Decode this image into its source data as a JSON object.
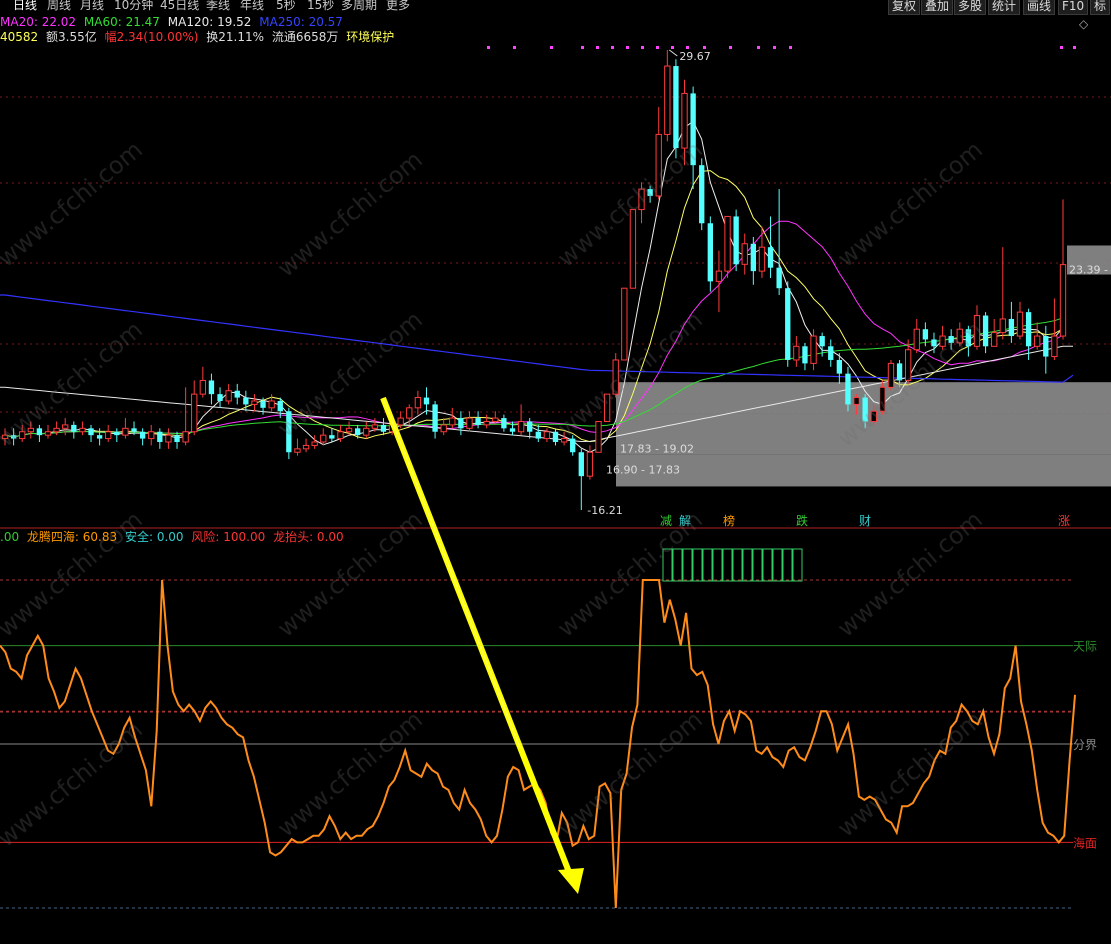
{
  "toolbar": {
    "periods": [
      "日线",
      "周线",
      "月线",
      "10分钟",
      "45日线",
      "季线",
      "年线",
      "5秒",
      "15秒",
      "多周期",
      "更多"
    ],
    "active_period": "日线",
    "arrow_label": "",
    "right_buttons": [
      "复权",
      "叠加",
      "多股",
      "统计",
      "画线",
      "F10",
      "标"
    ]
  },
  "ma_legend": [
    {
      "label": "MA20: 22.02",
      "color": "#ff33ff"
    },
    {
      "label": "MA60: 21.47",
      "color": "#33dd33"
    },
    {
      "label": "MA120: 19.52",
      "color": "#e8e8e8"
    },
    {
      "label": "MA250: 20.57",
      "color": "#3333ff"
    }
  ],
  "info_row": [
    {
      "label": "40582",
      "color": "#ffff55"
    },
    {
      "label": "额3.55亿",
      "color": "#dddddd"
    },
    {
      "label": "幅2.34(10.00%)",
      "color": "#ff3333"
    },
    {
      "label": "换21.11%",
      "color": "#dddddd"
    },
    {
      "label": "流通6658万",
      "color": "#dddddd"
    },
    {
      "label": "环境保护",
      "color": "#ffff55"
    }
  ],
  "indicator_legend": [
    {
      "label": ".00",
      "color": "#33cc33"
    },
    {
      "label": "龙腾四海: 60.83",
      "color": "#ff9900"
    },
    {
      "label": "安全: 0.00",
      "color": "#33cccc"
    },
    {
      "label": "风险: 100.00",
      "color": "#ff3333"
    },
    {
      "label": "龙抬头: 0.00",
      "color": "#ff3333"
    }
  ],
  "watermark": "www.cfchi.com",
  "chart_data": [
    {
      "type": "candlestick",
      "price_labels": [
        {
          "text": "29.67",
          "price": 29.67
        },
        {
          "text": "23.39 -",
          "price": 23.39
        },
        {
          "text": "-16.21",
          "price": 16.21
        }
      ],
      "zone_labels": [
        {
          "text": "17.83 - 19.02",
          "low": 17.83,
          "high": 19.02
        },
        {
          "text": "16.90 - 17.83",
          "low": 16.9,
          "high": 17.83
        }
      ],
      "event_markers": [
        {
          "text": "减",
          "color": "#33cc33"
        },
        {
          "text": "解",
          "color": "#33cccc"
        },
        {
          "text": "榜",
          "color": "#ff9900"
        },
        {
          "text": "跌",
          "color": "#33cc33"
        },
        {
          "text": "财",
          "color": "#33cccc"
        },
        {
          "text": "涨",
          "color": "#ff3333"
        }
      ],
      "series": [
        {
          "name": "MA20",
          "color": "#ff33ff"
        },
        {
          "name": "MA60",
          "color": "#33dd33"
        },
        {
          "name": "MA120",
          "color": "#e8e8e8"
        },
        {
          "name": "MA250",
          "color": "#3333ff"
        }
      ],
      "zones": [
        {
          "low": 16.9,
          "high": 17.83,
          "color": "#8a8a8a"
        },
        {
          "low": 17.83,
          "high": 19.02,
          "color": "#8a8a8a"
        },
        {
          "low": 19.02,
          "high": 19.95,
          "color": "#8a8a8a"
        },
        {
          "low": 23.1,
          "high": 23.95,
          "color": "#8a8a8a"
        }
      ],
      "candles": [
        [
          18.3,
          18.4,
          18.6,
          18.1
        ],
        [
          18.4,
          18.3,
          18.6,
          18.1
        ],
        [
          18.3,
          18.5,
          18.7,
          18.2
        ],
        [
          18.5,
          18.6,
          18.8,
          18.3
        ],
        [
          18.6,
          18.4,
          18.7,
          18.2
        ],
        [
          18.4,
          18.5,
          18.7,
          18.3
        ],
        [
          18.5,
          18.6,
          18.8,
          18.4
        ],
        [
          18.6,
          18.7,
          18.9,
          18.4
        ],
        [
          18.7,
          18.5,
          18.8,
          18.3
        ],
        [
          18.5,
          18.6,
          18.8,
          18.4
        ],
        [
          18.6,
          18.4,
          18.7,
          18.2
        ],
        [
          18.4,
          18.3,
          18.6,
          18.1
        ],
        [
          18.3,
          18.5,
          18.7,
          18.2
        ],
        [
          18.5,
          18.4,
          18.6,
          18.2
        ],
        [
          18.4,
          18.6,
          18.9,
          18.3
        ],
        [
          18.6,
          18.5,
          18.8,
          18.4
        ],
        [
          18.5,
          18.3,
          18.6,
          18.1
        ],
        [
          18.3,
          18.5,
          18.7,
          18.1
        ],
        [
          18.5,
          18.2,
          18.6,
          18.0
        ],
        [
          18.2,
          18.4,
          18.6,
          18.0
        ],
        [
          18.4,
          18.2,
          18.5,
          18.0
        ],
        [
          18.2,
          18.5,
          19.8,
          18.1
        ],
        [
          18.5,
          19.6,
          20.0,
          18.4
        ],
        [
          19.6,
          20.0,
          20.4,
          19.5
        ],
        [
          20.0,
          19.6,
          20.2,
          19.3
        ],
        [
          19.6,
          19.4,
          19.8,
          19.2
        ],
        [
          19.4,
          19.7,
          19.9,
          19.3
        ],
        [
          19.7,
          19.5,
          19.9,
          19.3
        ],
        [
          19.5,
          19.3,
          19.7,
          19.1
        ],
        [
          19.3,
          19.4,
          19.6,
          19.1
        ],
        [
          19.4,
          19.2,
          19.5,
          19.0
        ],
        [
          19.2,
          19.4,
          19.6,
          19.1
        ],
        [
          19.4,
          19.1,
          19.5,
          18.9
        ],
        [
          19.1,
          17.9,
          19.2,
          17.7
        ],
        [
          17.9,
          18.0,
          18.3,
          17.8
        ],
        [
          18.0,
          18.1,
          18.3,
          17.9
        ],
        [
          18.1,
          18.2,
          18.4,
          18.0
        ],
        [
          18.2,
          18.4,
          18.6,
          18.1
        ],
        [
          18.4,
          18.3,
          18.6,
          18.2
        ],
        [
          18.3,
          18.5,
          18.7,
          18.2
        ],
        [
          18.5,
          18.6,
          18.8,
          18.4
        ],
        [
          18.6,
          18.4,
          18.7,
          18.3
        ],
        [
          18.4,
          18.6,
          18.8,
          18.3
        ],
        [
          18.6,
          18.7,
          18.9,
          18.5
        ],
        [
          18.7,
          18.5,
          18.9,
          18.4
        ],
        [
          18.5,
          18.7,
          19.0,
          18.4
        ],
        [
          18.7,
          18.9,
          19.1,
          18.6
        ],
        [
          18.9,
          19.2,
          19.3,
          18.7
        ],
        [
          19.2,
          19.5,
          19.7,
          19.0
        ],
        [
          19.5,
          19.3,
          19.8,
          19.0
        ],
        [
          19.3,
          18.5,
          19.4,
          18.3
        ],
        [
          18.5,
          18.7,
          18.9,
          18.4
        ],
        [
          18.7,
          18.9,
          19.2,
          18.6
        ],
        [
          18.9,
          18.6,
          19.1,
          18.4
        ],
        [
          18.6,
          18.9,
          19.1,
          18.5
        ],
        [
          18.9,
          18.7,
          19.1,
          18.6
        ],
        [
          18.7,
          18.8,
          19.0,
          18.6
        ],
        [
          18.8,
          18.9,
          19.1,
          18.7
        ],
        [
          18.9,
          18.6,
          19.0,
          18.5
        ],
        [
          18.6,
          18.5,
          18.8,
          18.4
        ],
        [
          18.5,
          18.8,
          19.3,
          18.4
        ],
        [
          18.8,
          18.5,
          18.9,
          18.3
        ],
        [
          18.5,
          18.3,
          18.7,
          18.2
        ],
        [
          18.3,
          18.5,
          18.6,
          18.2
        ],
        [
          18.5,
          18.2,
          18.6,
          18.1
        ],
        [
          18.2,
          18.3,
          18.5,
          18.1
        ],
        [
          18.3,
          17.9,
          18.4,
          17.8
        ],
        [
          17.9,
          17.2,
          18.0,
          16.21
        ],
        [
          17.2,
          17.9,
          18.1,
          17.1
        ],
        [
          17.9,
          18.8,
          18.8,
          17.9
        ],
        [
          18.8,
          19.6,
          19.6,
          18.8
        ],
        [
          19.6,
          20.6,
          20.8,
          19.5
        ],
        [
          20.6,
          22.7,
          22.7,
          20.6
        ],
        [
          22.7,
          25.0,
          25.0,
          22.7
        ],
        [
          25.0,
          25.6,
          25.8,
          24.6
        ],
        [
          25.6,
          25.4,
          25.7,
          25.2
        ],
        [
          25.4,
          27.2,
          28.0,
          25.3
        ],
        [
          27.2,
          29.2,
          29.67,
          27.0
        ],
        [
          29.2,
          26.8,
          29.4,
          26.5
        ],
        [
          26.8,
          28.4,
          28.8,
          26.3
        ],
        [
          28.4,
          26.3,
          28.6,
          25.6
        ],
        [
          26.3,
          24.6,
          26.5,
          24.4
        ],
        [
          24.6,
          22.9,
          24.8,
          22.6
        ],
        [
          22.9,
          23.2,
          23.8,
          22.0
        ],
        [
          23.2,
          24.8,
          24.8,
          23.0
        ],
        [
          24.8,
          23.4,
          25.0,
          23.2
        ],
        [
          23.4,
          24.0,
          24.3,
          23.1
        ],
        [
          24.0,
          23.2,
          24.2,
          22.8
        ],
        [
          23.2,
          23.9,
          24.5,
          23.0
        ],
        [
          23.9,
          23.3,
          24.8,
          23.0
        ],
        [
          23.3,
          22.7,
          25.6,
          22.5
        ],
        [
          22.7,
          20.6,
          22.9,
          20.4
        ],
        [
          20.6,
          21.0,
          21.3,
          20.4
        ],
        [
          21.0,
          20.5,
          21.1,
          20.3
        ],
        [
          20.5,
          21.3,
          21.5,
          20.3
        ],
        [
          21.3,
          21.0,
          21.4,
          20.7
        ],
        [
          21.0,
          20.6,
          21.2,
          20.4
        ],
        [
          20.6,
          20.2,
          20.8,
          19.9
        ],
        [
          20.2,
          19.3,
          20.4,
          19.1
        ],
        [
          19.3,
          19.5,
          19.6,
          19.0
        ],
        [
          19.5,
          18.8,
          19.6,
          18.6
        ],
        [
          18.8,
          19.1,
          19.3,
          18.7
        ],
        [
          19.1,
          19.8,
          20.0,
          19.0
        ],
        [
          19.8,
          20.5,
          20.6,
          19.7
        ],
        [
          20.5,
          20.0,
          20.6,
          19.8
        ],
        [
          20.0,
          20.9,
          21.2,
          19.9
        ],
        [
          20.9,
          21.5,
          21.8,
          20.8
        ],
        [
          21.5,
          21.2,
          21.7,
          21.0
        ],
        [
          21.2,
          21.0,
          21.4,
          20.8
        ],
        [
          21.0,
          21.3,
          21.6,
          20.9
        ],
        [
          21.3,
          21.1,
          21.5,
          20.9
        ],
        [
          21.1,
          21.5,
          21.7,
          21.0
        ],
        [
          21.5,
          21.0,
          21.6,
          20.7
        ],
        [
          21.0,
          21.9,
          22.2,
          20.9
        ],
        [
          21.9,
          21.0,
          22.0,
          20.8
        ],
        [
          21.0,
          21.4,
          21.8,
          21.0
        ],
        [
          21.4,
          21.8,
          23.9,
          21.2
        ],
        [
          21.8,
          21.3,
          22.3,
          21.1
        ],
        [
          21.3,
          22.0,
          22.3,
          21.2
        ],
        [
          22.0,
          21.0,
          22.1,
          20.6
        ],
        [
          21.0,
          21.3,
          21.7,
          20.9
        ],
        [
          21.3,
          20.7,
          21.6,
          20.2
        ],
        [
          20.7,
          21.3,
          22.4,
          20.6
        ],
        [
          21.3,
          23.39,
          25.3,
          21.2
        ]
      ]
    },
    {
      "type": "line",
      "title": "龙腾四海",
      "ylim": [
        0,
        100
      ],
      "reference_lines": [
        {
          "text": "天际",
          "value": 80,
          "color": "#2a8a2a"
        },
        {
          "text": "分界",
          "value": 50,
          "color": "#888888"
        },
        {
          "text": "海面",
          "value": 20,
          "color": "#dd2222"
        }
      ],
      "dashed_lines": [
        {
          "value": 100,
          "color": "#aa3333"
        },
        {
          "value": 60,
          "color": "#aa3333"
        },
        {
          "value": 0,
          "color": "#446688"
        }
      ],
      "series": [
        {
          "name": "龙腾四海",
          "color": "#ff8c1a",
          "values": [
            80,
            78,
            73,
            72,
            70,
            77,
            80,
            83,
            80,
            70,
            66,
            61,
            63,
            68,
            73,
            70,
            65,
            60,
            56,
            52,
            48,
            47,
            50,
            55,
            58,
            52,
            47,
            42,
            31,
            54,
            100,
            80,
            66,
            62,
            60,
            62,
            60,
            57,
            61,
            63,
            61,
            58,
            56,
            55,
            53,
            52,
            45,
            40,
            33,
            26,
            17,
            16,
            17,
            19,
            21,
            20,
            20,
            21,
            22,
            22,
            24,
            28,
            25,
            21,
            23,
            21,
            22,
            22,
            24,
            25,
            28,
            32,
            37,
            39,
            43,
            48,
            42,
            41,
            40,
            44,
            42,
            41,
            37,
            36,
            32,
            30,
            36,
            32,
            30,
            27,
            22,
            20,
            22,
            30,
            40,
            43,
            42,
            36,
            37,
            38,
            36,
            32,
            23,
            20,
            29,
            26,
            19,
            20,
            25,
            21,
            22,
            37,
            38,
            35,
            0,
            36,
            41,
            55,
            62,
            100,
            100,
            100,
            100,
            87,
            94,
            88,
            80,
            90,
            73,
            71,
            72,
            68,
            56,
            50,
            57,
            60,
            54,
            60,
            59,
            57,
            48,
            47,
            49,
            46,
            45,
            43,
            48,
            49,
            46,
            45,
            49,
            54,
            60,
            60,
            56,
            48,
            52,
            56,
            47,
            34,
            33,
            34,
            33,
            30,
            27,
            26,
            23,
            31,
            31,
            32,
            35,
            38,
            40,
            45,
            48,
            47,
            55,
            57,
            62,
            60,
            57,
            56,
            60,
            52,
            47,
            53,
            67,
            70,
            80,
            63,
            56,
            48,
            36,
            26,
            23,
            22,
            20,
            22,
            45,
            65
          ]
        }
      ],
      "volume_boxes": {
        "count": 14,
        "color": "#33cc66"
      }
    }
  ]
}
